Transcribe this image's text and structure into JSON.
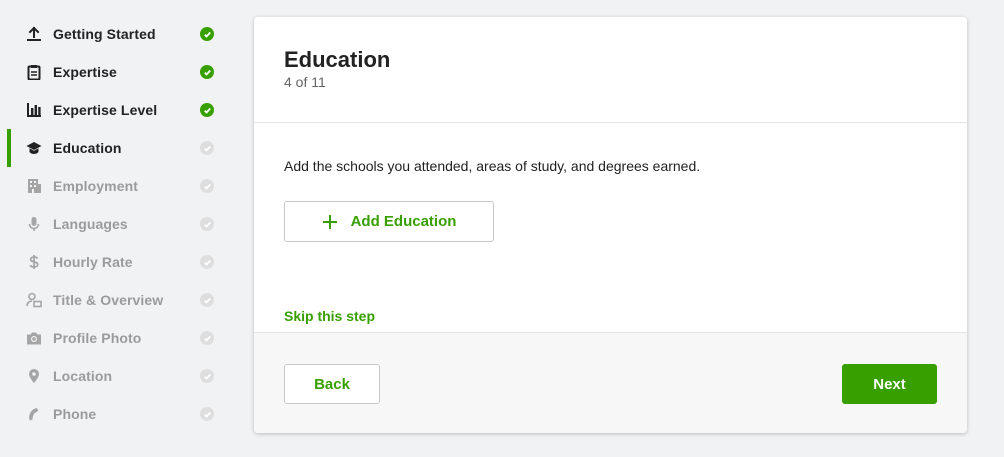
{
  "sidebar": {
    "items": [
      {
        "label": "Getting Started",
        "icon": "upload-icon",
        "state": "done"
      },
      {
        "label": "Expertise",
        "icon": "clipboard-icon",
        "state": "done"
      },
      {
        "label": "Expertise Level",
        "icon": "bar-chart-icon",
        "state": "done"
      },
      {
        "label": "Education",
        "icon": "graduation-cap-icon",
        "state": "current"
      },
      {
        "label": "Employment",
        "icon": "building-icon",
        "state": "pending"
      },
      {
        "label": "Languages",
        "icon": "microphone-icon",
        "state": "pending"
      },
      {
        "label": "Hourly Rate",
        "icon": "dollar-icon",
        "state": "pending"
      },
      {
        "label": "Title & Overview",
        "icon": "profile-edit-icon",
        "state": "pending"
      },
      {
        "label": "Profile Photo",
        "icon": "camera-icon",
        "state": "pending"
      },
      {
        "label": "Location",
        "icon": "map-pin-icon",
        "state": "pending"
      },
      {
        "label": "Phone",
        "icon": "phone-icon",
        "state": "pending"
      }
    ]
  },
  "main": {
    "title": "Education",
    "step": "4 of 11",
    "description": "Add the schools you attended, areas of study, and degrees earned.",
    "add_button": "Add Education",
    "skip_link": "Skip this step",
    "back_button": "Back",
    "next_button": "Next"
  },
  "colors": {
    "accent": "#37a000",
    "background": "#f1f2f4",
    "pending_text": "#9b9b9b",
    "pending_dot": "#dedede"
  }
}
